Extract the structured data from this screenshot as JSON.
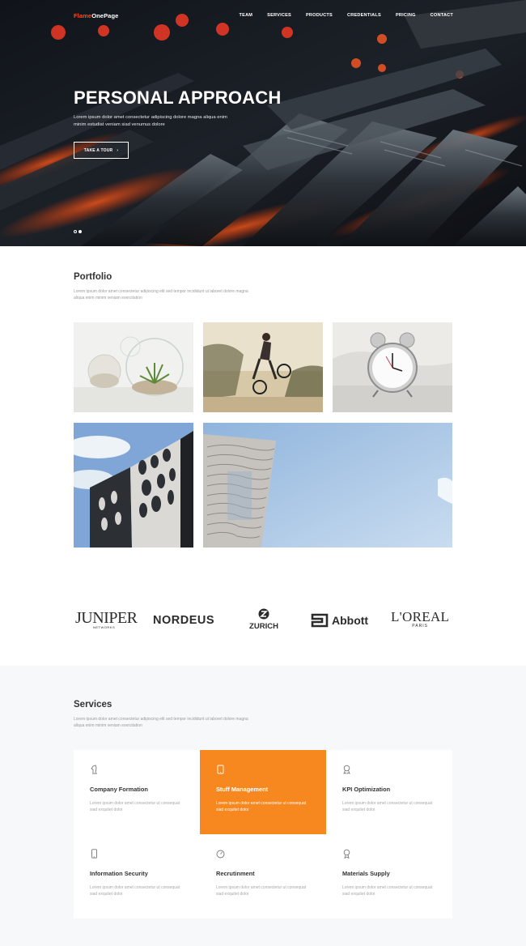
{
  "header": {
    "brand_part1": "Flame",
    "brand_part2": "OnePage",
    "nav": [
      "TEAM",
      "SERVICES",
      "PRODUCTS",
      "CREDENTIALS",
      "PRICING",
      "CONTACT"
    ]
  },
  "hero": {
    "title": "PERSONAL APPROACH",
    "subtitle": "Lorem ipsum dolor amet consectetur adipiscing dolore magna aliqua enim minim estudiat veniam siad venumus dolore",
    "button_label": "TAKE A TOUR",
    "slide_count": 2,
    "active_slide": 2
  },
  "portfolio": {
    "title": "Portfolio",
    "description": "Lorem ipsum dolor amet consectetur adipiscing elit sed tempor incididunt ut laboret dolore magna aliqua enim minim veniam exercitation",
    "items": [
      "succulents-in-glass",
      "bmx-rider",
      "alarm-clock",
      "perforated-facade",
      "wavy-skyscraper"
    ]
  },
  "clients": [
    "JUNIPER",
    "NETWORKS",
    "NORDEUS",
    "ZURICH",
    "Abbott",
    "L'OREAL",
    "PARIS"
  ],
  "services": {
    "title": "Services",
    "description": "Lorem ipsum dolor amet consectetur adipiscing elit sed tempor incididunt ut laboret dolore magna aliqua enim minim veniam exercitation",
    "items": [
      {
        "title": "Company Formation",
        "text": "Lorem ipsum dolor amet consectetur ut consequat siad exquitet dolor",
        "icon": "chess-knight-icon"
      },
      {
        "title": "Stuff Management",
        "text": "Lorem ipsum dolor amet consectetur ut consequat siad exquitet dolor",
        "icon": "tablet-icon"
      },
      {
        "title": "KPI Optimization",
        "text": "Lorem ipsum dolor amet consectetur ut consequat siad exquitet dolor",
        "icon": "award-icon"
      },
      {
        "title": "Information Security",
        "text": "Lorem ipsum dolor amet consectetur ut consequat siad exquitet dolor",
        "icon": "phone-icon"
      },
      {
        "title": "Recrutinment",
        "text": "Lorem ipsum dolor amet consectetur ut consequat siad exquitet dolor",
        "icon": "speedometer-icon"
      },
      {
        "title": "Materials Supply",
        "text": "Lorem ipsum dolor amet consectetur ut consequat siad exquitet dolor",
        "icon": "ribbon-icon"
      }
    ]
  },
  "colors": {
    "accent": "#f7871f",
    "brand_red": "#ff4a1a",
    "hero_dark": "#15181d"
  }
}
